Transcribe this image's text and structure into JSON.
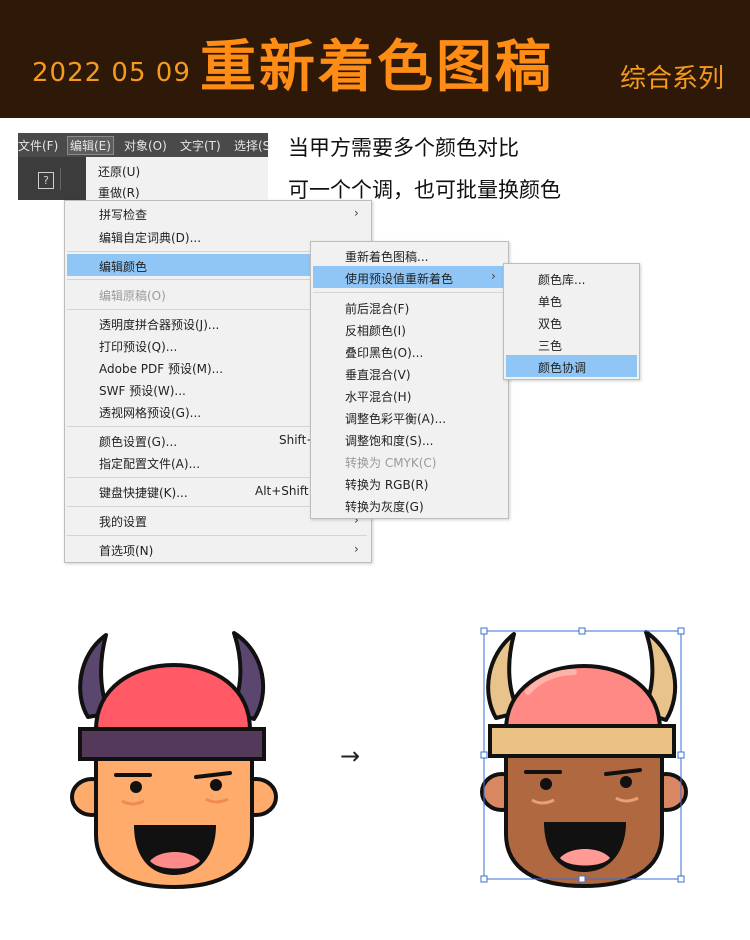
{
  "header": {
    "date": "2022 05 09",
    "title": "重新着色图稿",
    "series": "综合系列"
  },
  "menubar": {
    "items": [
      "文件(F)",
      "编辑(E)",
      "对象(O)",
      "文字(T)",
      "选择(S"
    ]
  },
  "notes": {
    "line1": "当甲方需要多个颜色对比",
    "line2": "可一个个调，也可批量换颜色"
  },
  "edit_menu": {
    "undo": "还原(U)",
    "redo": "重做(R)",
    "spell": "拼写检查",
    "dict": "编辑自定词典(D)...",
    "edit_colors": "编辑颜色",
    "edit_original": "编辑原稿(O)",
    "transparency": "透明度拼合器预设(J)...",
    "print_presets": "打印预设(Q)...",
    "pdf_presets": "Adobe PDF 预设(M)...",
    "swf_presets": "SWF 预设(W)...",
    "perspective_grid": "透视网格预设(G)...",
    "color_settings": "颜色设置(G)...",
    "color_settings_shortcut": "Shift+",
    "assign_profile": "指定配置文件(A)...",
    "shortcuts": "键盘快捷键(K)...",
    "shortcuts_shortcut": "Alt+Shift+",
    "my_settings": "我的设置",
    "preferences": "首选项(N)"
  },
  "edit_colors_menu": {
    "items": [
      "重新着色图稿...",
      "使用预设值重新着色",
      "前后混合(F)",
      "反相颜色(I)",
      "叠印黑色(O)...",
      "垂直混合(V)",
      "水平混合(H)",
      "调整色彩平衡(A)...",
      "调整饱和度(S)...",
      "转换为 CMYK(C)",
      "转换为 RGB(R)",
      "转换为灰度(G)"
    ]
  },
  "preset_menu": {
    "items": [
      "颜色库...",
      "单色",
      "双色",
      "三色",
      "颜色协调"
    ]
  },
  "arrow": "→",
  "colors": {
    "header_bg": "#2e1808",
    "header_accent": "#ff8c14",
    "highlight": "#8fc6f6",
    "original_helmet": "#ff5a66",
    "original_band": "#55395a",
    "original_horn": "#5b4670",
    "original_skin": "#ffab6b",
    "recolored_helmet": "#ff8a85",
    "recolored_band": "#ebc283",
    "recolored_horn": "#e8c48c",
    "recolored_skin": "#b06840",
    "selection": "#3a6fd8"
  }
}
